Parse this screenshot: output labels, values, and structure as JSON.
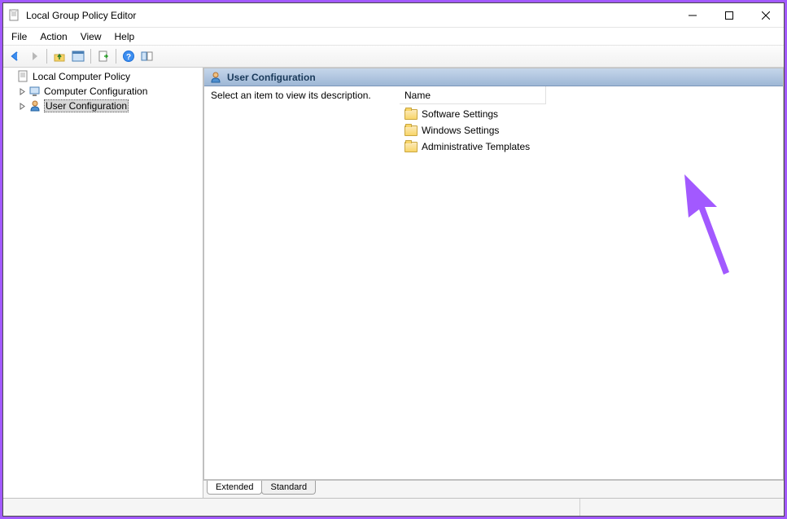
{
  "window": {
    "title": "Local Group Policy Editor"
  },
  "menubar": {
    "items": [
      "File",
      "Action",
      "View",
      "Help"
    ]
  },
  "toolbar": {
    "icons": [
      "back",
      "forward",
      "up",
      "properties",
      "export",
      "refresh",
      "help",
      "show-hide"
    ]
  },
  "tree": {
    "root": "Local Computer Policy",
    "children": [
      {
        "label": "Computer Configuration"
      },
      {
        "label": "User Configuration",
        "selected": true
      }
    ]
  },
  "content": {
    "header": "User Configuration",
    "description": "Select an item to view its description.",
    "column_name": "Name",
    "items": [
      "Software Settings",
      "Windows Settings",
      "Administrative Templates"
    ]
  },
  "tabs": {
    "extended": "Extended",
    "standard": "Standard"
  }
}
